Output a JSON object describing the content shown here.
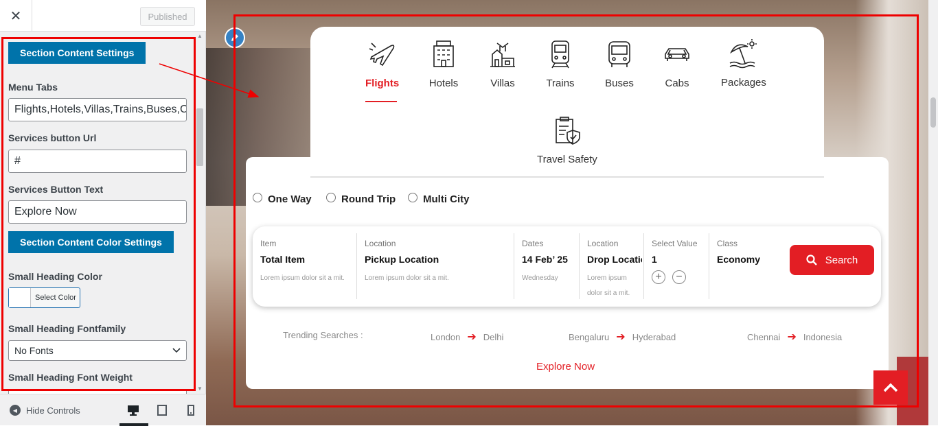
{
  "sidebar": {
    "close_icon": "✕",
    "published_label": "Published",
    "section_content_settings": "Section Content Settings",
    "menu_tabs_label": "Menu Tabs",
    "menu_tabs_value": "Flights,Hotels,Villas,Trains,Buses,Cabs,Packages,Travel Safety",
    "services_url_label": "Services button Url",
    "services_url_value": "#",
    "services_text_label": "Services Button Text",
    "services_text_value": "Explore Now",
    "section_color_settings": "Section Content Color Settings",
    "small_heading_color_label": "Small Heading Color",
    "select_color_label": "Select Color",
    "small_heading_fontfamily_label": "Small Heading Fontfamily",
    "fontfamily_value": "No Fonts",
    "small_heading_weight_label": "Small Heading Font Weight",
    "hide_controls_label": "Hide Controls",
    "accent_color": "#0073aa"
  },
  "preview": {
    "tabs": [
      {
        "label": "Flights",
        "icon": "airplane-icon",
        "active": true
      },
      {
        "label": "Hotels",
        "icon": "hotel-icon",
        "active": false
      },
      {
        "label": "Villas",
        "icon": "villa-icon",
        "active": false
      },
      {
        "label": "Trains",
        "icon": "train-icon",
        "active": false
      },
      {
        "label": "Buses",
        "icon": "bus-icon",
        "active": false
      },
      {
        "label": "Cabs",
        "icon": "cab-icon",
        "active": false
      },
      {
        "label": "Packages",
        "icon": "beach-umbrella-icon",
        "active": false
      },
      {
        "label": "Travel Safety",
        "icon": "clipboard-shield-icon",
        "active": false
      }
    ],
    "trip_types": [
      "One Way",
      "Round Trip",
      "Multi City"
    ],
    "fields": [
      {
        "caption": "Item",
        "value": "Total Item",
        "sub": "Lorem ipsum dolor sit a mit."
      },
      {
        "caption": "Location",
        "value": "Pickup Location",
        "sub": "Lorem ipsum dolor sit a mit."
      },
      {
        "caption": "Dates",
        "value": "14 Feb’ 25",
        "sub": "Wednesday"
      },
      {
        "caption": "Location",
        "value": "Drop Location",
        "sub": "Lorem ipsum dolor sit a mit."
      },
      {
        "caption": "Select Value",
        "value": "1",
        "sub": ""
      },
      {
        "caption": "Class",
        "value": "Economy",
        "sub": ""
      }
    ],
    "stepper": {
      "plus": "+",
      "minus": "−"
    },
    "search_label": "Search",
    "trending_label": "Trending Searches :",
    "trending": [
      {
        "from": "London",
        "to": "Delhi"
      },
      {
        "from": "Bengaluru",
        "to": "Hyderabad"
      },
      {
        "from": "Chennai",
        "to": "Indonesia"
      }
    ],
    "arrow_glyph": "➔",
    "explore_label": "Explore Now",
    "accent_color": "#e31e24"
  }
}
